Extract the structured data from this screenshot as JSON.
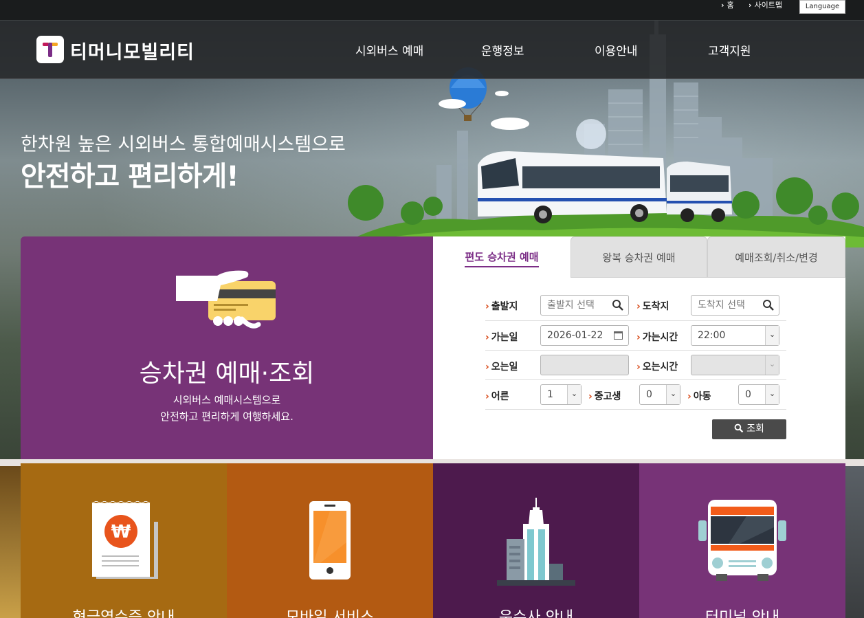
{
  "utility": {
    "home": "홈",
    "sitemap": "사이트맵",
    "language": "Language"
  },
  "header": {
    "logo_text": "티머니모빌리티",
    "nav": [
      "시외버스 예매",
      "운행정보",
      "이용안내",
      "고객지원"
    ]
  },
  "hero": {
    "subtitle": "한차원 높은 시외버스 통합예매시스템으로",
    "title": "안전하고 편리하게!"
  },
  "panel": {
    "title": "승차권 예매·조회",
    "desc_line1": "시외버스 예매시스템으로",
    "desc_line2": "안전하고 편리하게 여행하세요."
  },
  "tabs": [
    "편도 승차권 예매",
    "왕복 승차권 예매",
    "예매조회/취소/변경"
  ],
  "form": {
    "depart_label": "출발지",
    "depart_placeholder": "출발지 선택",
    "arrive_label": "도착지",
    "arrive_placeholder": "도착지 선택",
    "go_date_label": "가는일",
    "go_date_value": "2026-01-22",
    "go_time_label": "가는시간",
    "go_time_value": "22:00",
    "return_date_label": "오는일",
    "return_time_label": "오는시간",
    "adult_label": "어른",
    "adult_value": "1",
    "student_label": "중고생",
    "student_value": "0",
    "child_label": "아동",
    "child_value": "0",
    "search_label": "조회"
  },
  "tiles": [
    {
      "label": "현금영수증 안내",
      "color": "#a66a12"
    },
    {
      "label": "모바일 서비스",
      "color": "#b35a12"
    },
    {
      "label": "운수사 안내",
      "color": "#4d1a4d"
    },
    {
      "label": "터미널 안내",
      "color": "#773377"
    }
  ],
  "colors": {
    "purple": "#773377",
    "accent_orange": "#d94b1a"
  }
}
